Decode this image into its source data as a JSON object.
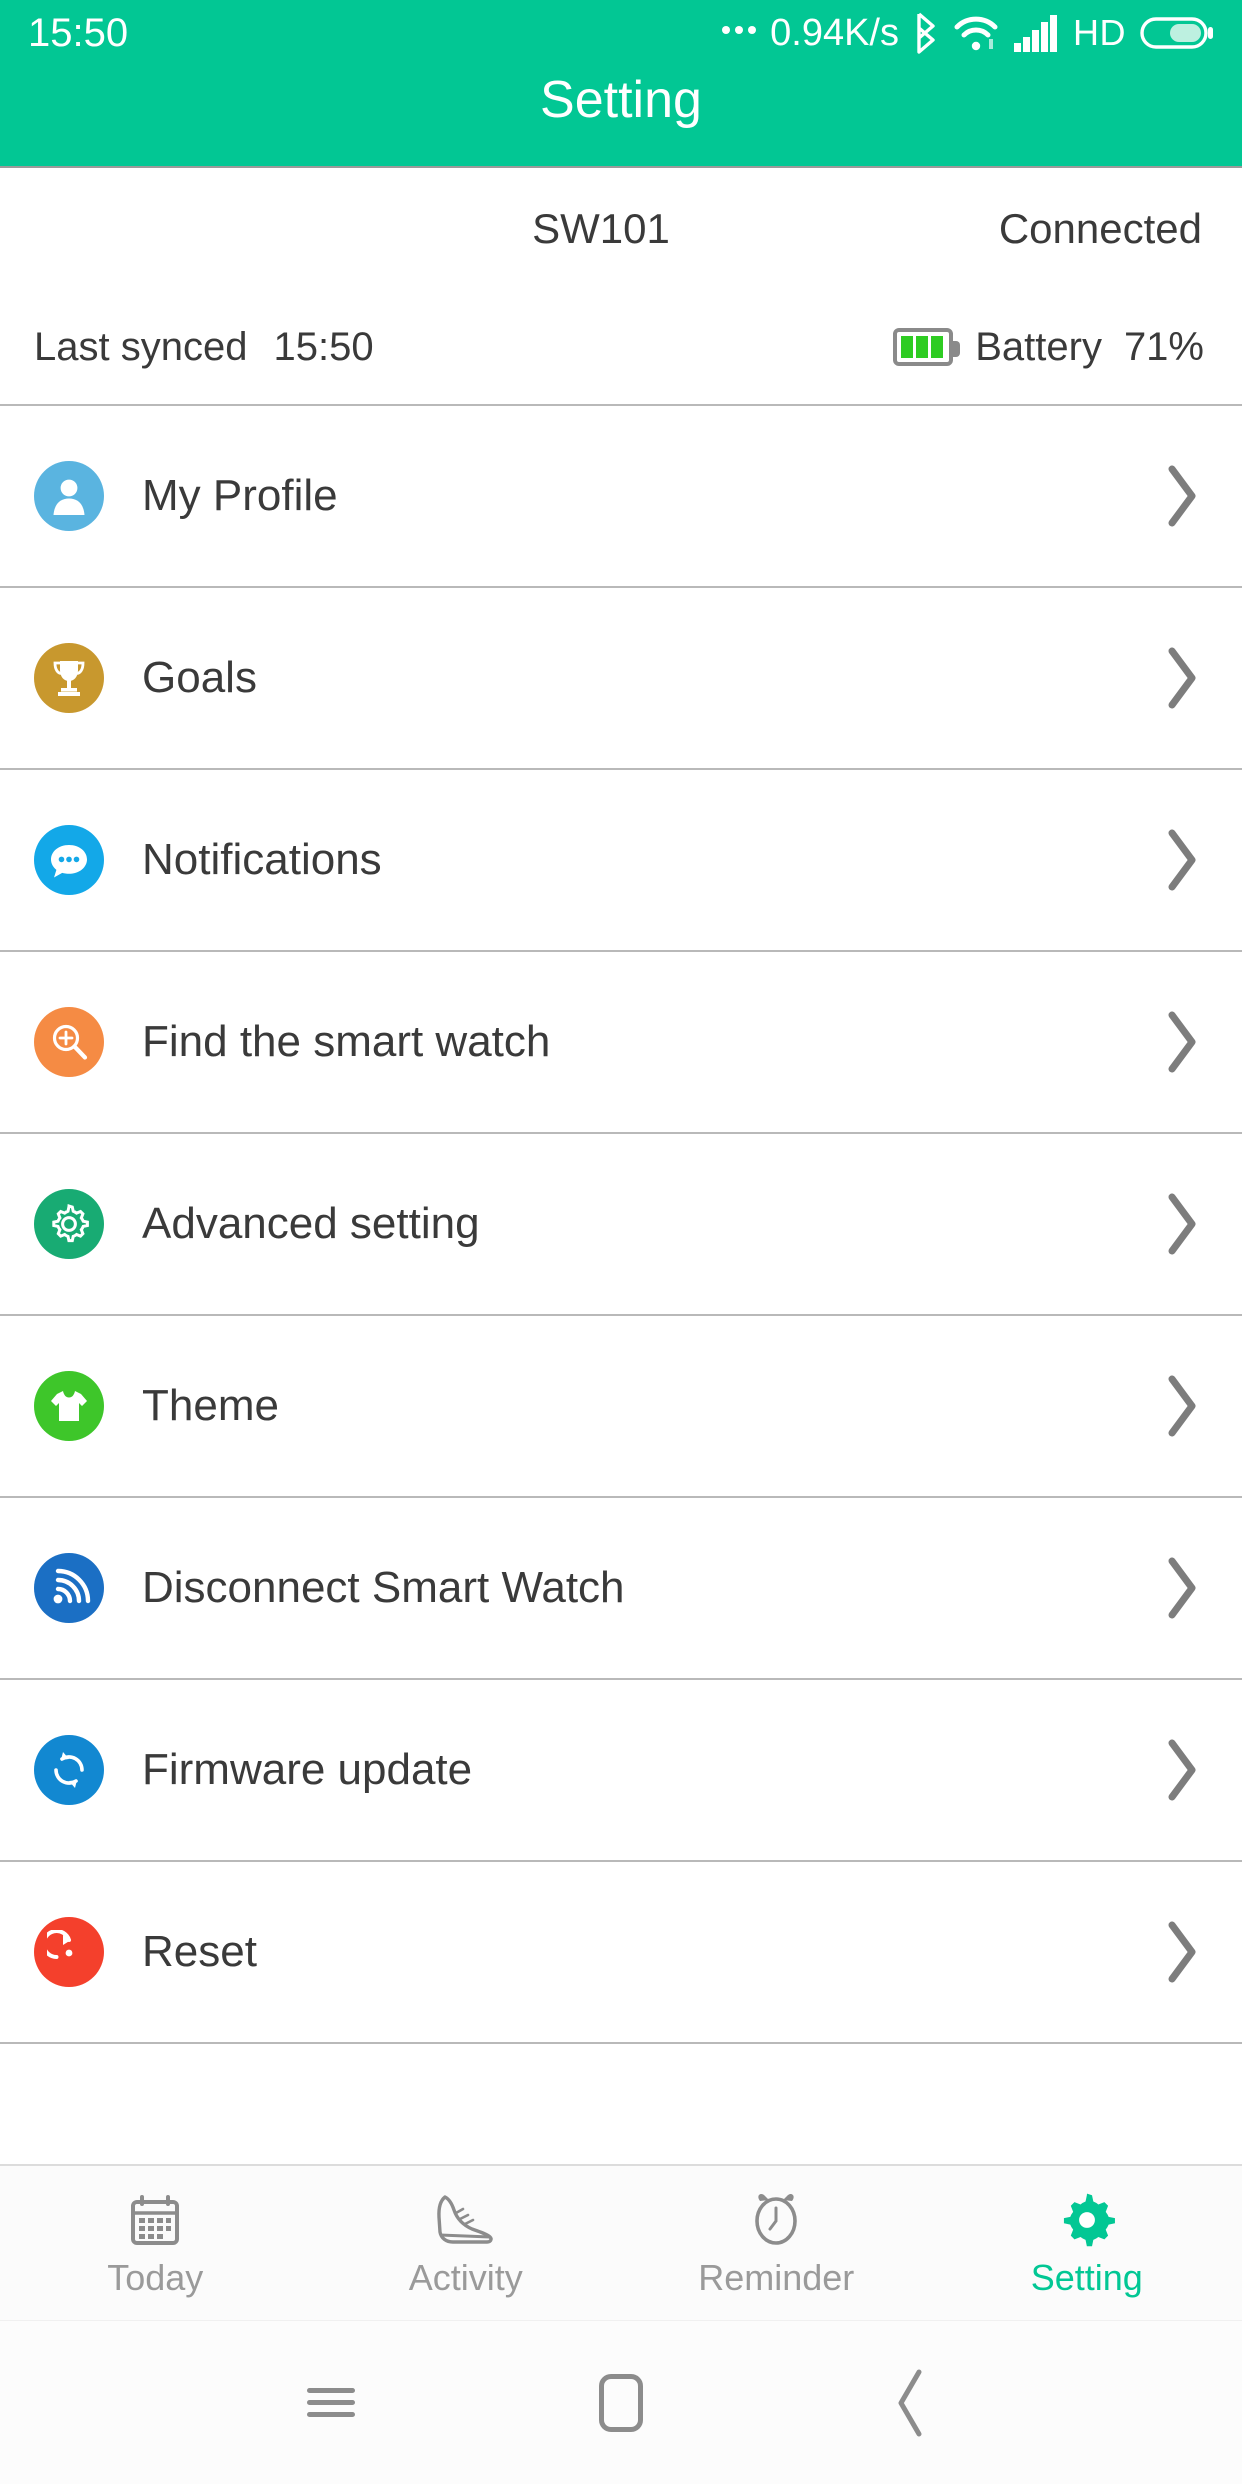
{
  "statusbar": {
    "clock": "15:50",
    "net_rate": "0.94K/s",
    "dots_icon": "overflow-dots-icon",
    "bluetooth_icon": "bluetooth-icon",
    "wifi_icon": "wifi-icon",
    "signal_icon": "signal-bars-icon",
    "hd_label": "HD",
    "battery_icon": "battery-icon"
  },
  "header": {
    "title": "Setting",
    "bg_color": "#02c794"
  },
  "device": {
    "name": "SW101",
    "status": "Connected",
    "last_synced_label": "Last synced",
    "last_synced_time": "15:50",
    "battery_label": "Battery",
    "battery_percent": "71%",
    "battery_icon": "battery-level-icon",
    "battery_bars": 3
  },
  "list": {
    "chevron_icon": "chevron-right-icon",
    "items": [
      {
        "label": "My Profile",
        "icon": "person-icon",
        "color": "#5ab4e0"
      },
      {
        "label": "Goals",
        "icon": "trophy-icon",
        "color": "#c8982e"
      },
      {
        "label": "Notifications",
        "icon": "chat-bubble-icon",
        "color": "#13a8e8"
      },
      {
        "label": "Find the smart watch",
        "icon": "search-plus-icon",
        "color": "#f58b44"
      },
      {
        "label": "Advanced setting",
        "icon": "gear-icon",
        "color": "#18ab73"
      },
      {
        "label": "Theme",
        "icon": "tshirt-icon",
        "color": "#3ec62a"
      },
      {
        "label": "Disconnect Smart Watch",
        "icon": "signal-waves-icon",
        "color": "#1b6fc4"
      },
      {
        "label": "Firmware update",
        "icon": "refresh-cycle-icon",
        "color": "#1288d1"
      },
      {
        "label": "Reset",
        "icon": "reset-arrow-icon",
        "color": "#f4402c"
      }
    ]
  },
  "tabbar": {
    "active_color": "#02c794",
    "inactive_color": "#9a9a9a",
    "tabs": [
      {
        "label": "Today",
        "icon": "calendar-icon",
        "active": false
      },
      {
        "label": "Activity",
        "icon": "sneaker-icon",
        "active": false
      },
      {
        "label": "Reminder",
        "icon": "alarm-clock-icon",
        "active": false
      },
      {
        "label": "Setting",
        "icon": "gear-icon",
        "active": true
      }
    ]
  },
  "navbar": {
    "menu_icon": "menu-icon",
    "home_icon": "home-square-icon",
    "back_icon": "back-chevron-icon"
  }
}
